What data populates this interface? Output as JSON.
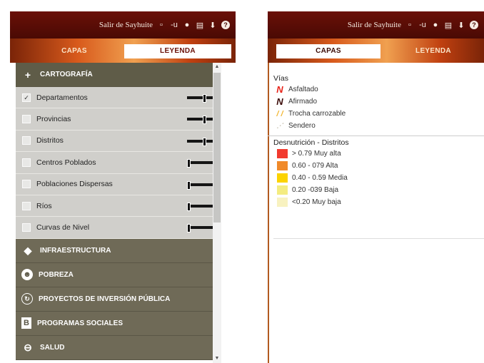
{
  "window": {
    "exit_label": "Salir de Sayhuite"
  },
  "toolbar_icons": [
    "minimize-icon",
    "user-icon",
    "print-icon",
    "download-icon",
    "help-icon"
  ],
  "tabs": {
    "capas": "CAPAS",
    "leyenda": "LEYENDA"
  },
  "categories": [
    {
      "label": "CARTOGRAFÍA",
      "icon": "plus-icon",
      "open": true
    },
    {
      "label": "INFRAESTRUCTURA",
      "icon": "cube-icon"
    },
    {
      "label": "POBREZA",
      "icon": "people-icon"
    },
    {
      "label": "PROYECTOS DE INVERSIÓN PÚBLICA",
      "icon": "refresh-icon"
    },
    {
      "label": "PROGRAMAS SOCIALES",
      "icon": "b-icon"
    },
    {
      "label": "SALUD",
      "icon": "health-icon"
    }
  ],
  "layers": [
    {
      "label": "Departamentos",
      "checked": true,
      "opacity": 0.55
    },
    {
      "label": "Provincias",
      "checked": false,
      "opacity": 0.55
    },
    {
      "label": "Distritos",
      "checked": false,
      "opacity": 0.55
    },
    {
      "label": "Centros Poblados",
      "checked": false,
      "opacity": 0.0
    },
    {
      "label": "Poblaciones Dispersas",
      "checked": false,
      "opacity": 0.0
    },
    {
      "label": "Ríos",
      "checked": false,
      "opacity": 0.0
    },
    {
      "label": "Curvas de Nivel",
      "checked": false,
      "opacity": 0.0
    }
  ],
  "legend": {
    "vias": {
      "title": "Vías",
      "items": [
        {
          "label": "Asfaltado",
          "color": "#e8241a"
        },
        {
          "label": "Afirmado",
          "color": "#3a0a08"
        },
        {
          "label": "Trocha carrozable",
          "color": "#f2b630"
        },
        {
          "label": "Sendero",
          "color": "#c8c0b0"
        }
      ]
    },
    "desnutricion": {
      "title": "Desnutrición - Distritos",
      "items": [
        {
          "label": "> 0.79 Muy alta",
          "color": "#f23a2e"
        },
        {
          "label": "0.60 - 079 Alta",
          "color": "#f08a2a"
        },
        {
          "label": "0.40 - 0.59 Media",
          "color": "#fcd300"
        },
        {
          "label": "0.20 -039 Baja",
          "color": "#f4ec80"
        },
        {
          "label": "<0.20 Muy baja",
          "color": "#f8f2c0"
        }
      ]
    }
  }
}
